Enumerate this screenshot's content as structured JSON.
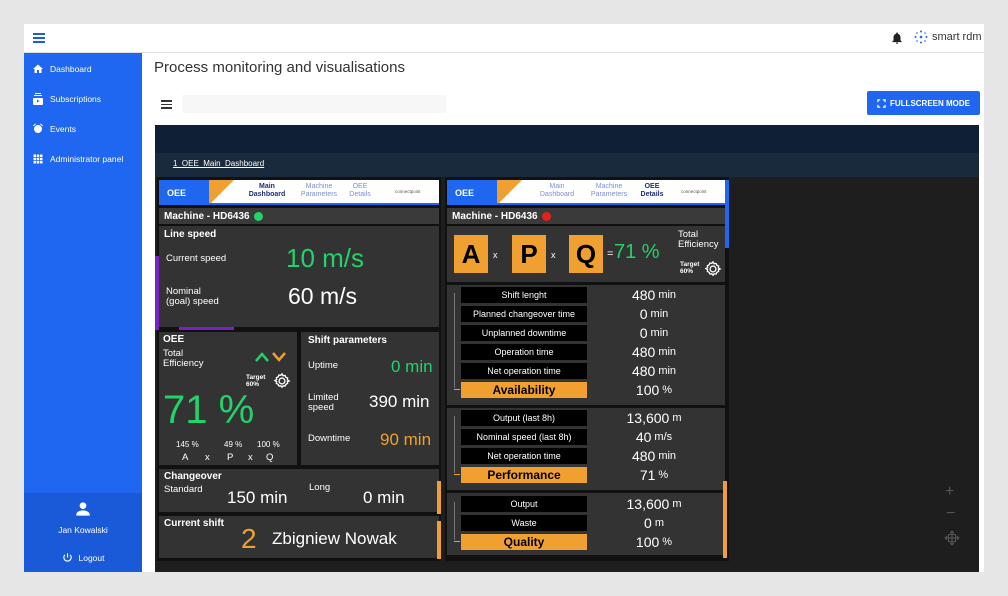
{
  "topbar": {
    "brand": "smart rdm",
    "menu_icon": "menu-icon",
    "notification_icon": "bell-icon"
  },
  "sidebar": {
    "items": [
      {
        "label": "Dashboard",
        "icon": "home-icon"
      },
      {
        "label": "Subscriptions",
        "icon": "subscriptions-icon"
      },
      {
        "label": "Events",
        "icon": "alarm-icon"
      },
      {
        "label": "Administrator panel",
        "icon": "grid-icon"
      }
    ],
    "user_name": "Jan Kowalski",
    "logout": "Logout"
  },
  "main": {
    "title": "Process monitoring and visualisations",
    "fullscreen_label": "FULLSCREEN MODE"
  },
  "dashboard": {
    "tab": "1_OEE_Main_Dashboard",
    "colors": {
      "blue": "#1f66f0",
      "orange": "#f0a030",
      "green": "#22d36a",
      "purple": "#7a22c8",
      "red": "#e62020"
    },
    "left": {
      "logo": "OEE",
      "nav": [
        "Main Dashboard",
        "Machine Parameters",
        "OEE Details"
      ],
      "brand": "connectpoint",
      "machine": "Machine - HD6436",
      "status": "green",
      "line_speed": {
        "title": "Line speed",
        "current_label": "Current speed",
        "current_value": "10 m/s",
        "nominal_label_1": "Nominal",
        "nominal_label_2": "(goal) speed",
        "nominal_value": "60 m/s"
      },
      "oee": {
        "title": "OEE",
        "total_1": "Total",
        "total_2": "Efficiency",
        "target_1": "Target",
        "target_2": "60%",
        "value": "71 %",
        "a_pct": "145 %",
        "p_pct": "49 %",
        "q_pct": "100 %",
        "a": "A",
        "x1": "x",
        "p": "P",
        "x2": "x",
        "q": "Q"
      },
      "shift_params": {
        "title": "Shift parameters",
        "uptime_label": "Uptime",
        "uptime_value": "0 min",
        "limited_1": "Limited",
        "limited_2": "speed",
        "limited_value": "390 min",
        "downtime_label": "Downtime",
        "downtime_value": "90 min"
      },
      "changeover": {
        "title": "Changeover",
        "standard_label": "Standard",
        "standard_value": "150 min",
        "long_label": "Long",
        "long_value": "0 min"
      },
      "current_shift": {
        "title": "Current shift",
        "number": "2",
        "name": "Zbigniew Nowak"
      }
    },
    "right": {
      "logo": "OEE",
      "nav": [
        "Main Dashboard",
        "Machine Parameters",
        "OEE Details"
      ],
      "brand": "connectpoint",
      "machine": "Machine - HD6436",
      "status": "red",
      "apq": {
        "a": "A",
        "x1": "x",
        "p": "P",
        "x2": "x",
        "q": "Q",
        "eq": "=",
        "value": "71 %",
        "total_1": "Total",
        "total_2": "Efficiency",
        "target_1": "Target",
        "target_2": "60%"
      },
      "availability": [
        {
          "k": "Shift lenght",
          "v": "480",
          "u": "min"
        },
        {
          "k": "Planned changeover time",
          "v": "0",
          "u": "min"
        },
        {
          "k": "Unplanned downtime",
          "v": "0",
          "u": "min"
        },
        {
          "k": "Operation time",
          "v": "480",
          "u": "min"
        },
        {
          "k": "Net operation time",
          "v": "480",
          "u": "min"
        },
        {
          "k": "Availability",
          "v": "100",
          "u": "%",
          "hl": true
        }
      ],
      "performance": [
        {
          "k": "Output (last 8h)",
          "v": "13,600",
          "u": "m"
        },
        {
          "k": "Nominal speed (last 8h)",
          "v": "40",
          "u": "m/s"
        },
        {
          "k": "Net operation time",
          "v": "480",
          "u": "min"
        },
        {
          "k": "Performance",
          "v": "71",
          "u": "%",
          "hl": true
        }
      ],
      "quality": [
        {
          "k": "Output",
          "v": "13,600",
          "u": "m"
        },
        {
          "k": "Waste",
          "v": "0",
          "u": "m"
        },
        {
          "k": "Quality",
          "v": "100",
          "u": "%",
          "hl": true
        }
      ]
    },
    "zoom": {
      "plus": "+",
      "minus": "−"
    }
  }
}
